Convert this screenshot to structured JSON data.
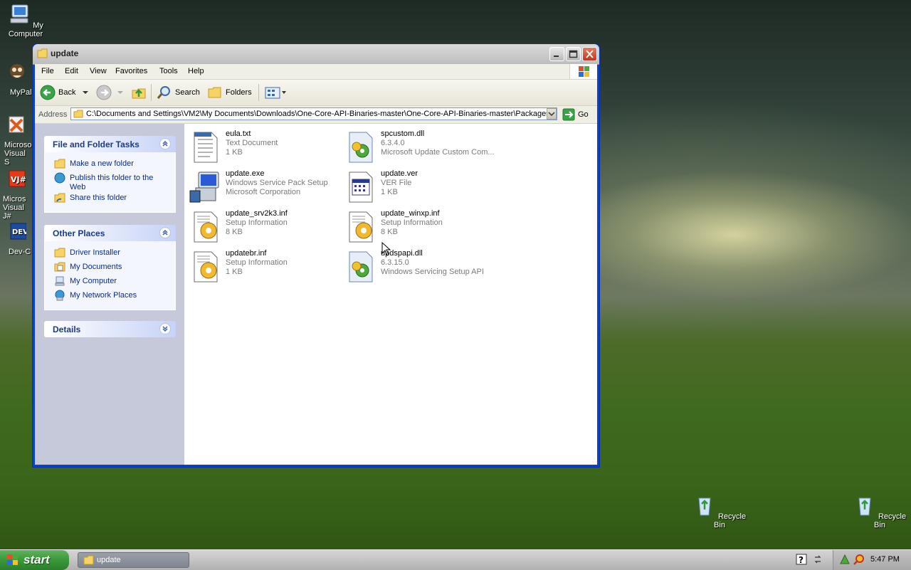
{
  "desktop": {
    "icons": [
      {
        "label": "My Computer"
      },
      {
        "label": "MyPal"
      },
      {
        "label": "Microso Visual S"
      },
      {
        "label": "Micros Visual J#"
      },
      {
        "label": "Dev-C"
      },
      {
        "label": "Recycle Bin"
      },
      {
        "label": "Recycle Bin"
      }
    ]
  },
  "window": {
    "title": "update",
    "menu": [
      "File",
      "Edit",
      "View",
      "Favorites",
      "Tools",
      "Help"
    ],
    "toolbar": {
      "back_label": "Back",
      "search_label": "Search",
      "folders_label": "Folders"
    },
    "address": {
      "label": "Address",
      "path": "C:\\Documents and Settings\\VM2\\My Documents\\Downloads\\One-Core-API-Binaries-master\\One-Core-API-Binaries-master\\Packages\\x",
      "go_label": "Go"
    },
    "tasks_panel": {
      "title": "File and Folder Tasks",
      "items": [
        "Make a new folder",
        "Publish this folder to the Web",
        "Share this folder"
      ]
    },
    "places_panel": {
      "title": "Other Places",
      "items": [
        "Driver Installer",
        "My Documents",
        "My Computer",
        "My Network Places"
      ]
    },
    "details_panel": {
      "title": "Details"
    },
    "files": [
      {
        "name": "eula.txt",
        "line2": "Text Document",
        "line3": "1 KB",
        "icon": "text-file-icon"
      },
      {
        "name": "spcustom.dll",
        "line2": "6.3.4.0",
        "line3": "Microsoft Update Custom Com...",
        "icon": "dll-file-icon"
      },
      {
        "name": "update.exe",
        "line2": "Windows Service Pack Setup",
        "line3": "Microsoft Corporation",
        "icon": "setup-exe-icon"
      },
      {
        "name": "update.ver",
        "line2": "VER File",
        "line3": "1 KB",
        "icon": "ver-file-icon"
      },
      {
        "name": "update_srv2k3.inf",
        "line2": "Setup Information",
        "line3": "8 KB",
        "icon": "inf-file-icon"
      },
      {
        "name": "update_winxp.inf",
        "line2": "Setup Information",
        "line3": "8 KB",
        "icon": "inf-file-icon"
      },
      {
        "name": "updatebr.inf",
        "line2": "Setup Information",
        "line3": "1 KB",
        "icon": "inf-file-icon"
      },
      {
        "name": "updspapi.dll",
        "line2": "6.3.15.0",
        "line3": "Windows Servicing Setup API",
        "icon": "dll-file-icon"
      }
    ]
  },
  "taskbar": {
    "start_label": "start",
    "task_item_label": "update",
    "clock": "5:47 PM"
  }
}
